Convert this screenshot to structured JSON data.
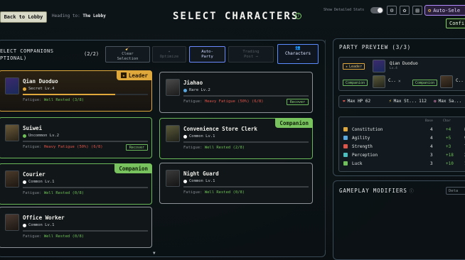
{
  "header": {
    "back_label": "Back to Lobby",
    "heading_prefix": "Heading to:",
    "heading_dest": "The Lobby",
    "title": "SELECT CHARACTERS",
    "help_glyph": "?",
    "show_stats_label": "Show Detailed Stats",
    "auto_select_label": "Auto-Sele",
    "confirm_label": "Confi",
    "icons": [
      "settings-icon",
      "gear-icon",
      "bookmark-icon"
    ]
  },
  "companions": {
    "heading_line1": "ELECT COMPANIONS",
    "heading_line2": "PTIONAL)",
    "count": "(2/2)",
    "buttons": {
      "clear_line1": "Clear",
      "clear_line2": "Selection",
      "optimize": "Optimize",
      "auto_line1": "Auto-",
      "auto_line2": "Party",
      "trading_line1": "Trading",
      "trading_line2": "Post →",
      "characters_line1": "Characters",
      "characters_line2": "→"
    },
    "cards": [
      {
        "name": "Qian Duoduo",
        "rank": "Secret Lv.4",
        "fatigue_label": "Fatigue:",
        "fatigue": "Well Rested (3/8)",
        "tag": "Leader",
        "rank_color": "#e0a83a",
        "fatigue_ok": true,
        "bar": 0.8
      },
      {
        "name": "Jiahao",
        "rank": "Rare Lv.2",
        "fatigue_label": "Fatigue:",
        "fatigue": "Heavy Fatigue (50%) (6/8)",
        "recover": "Recover",
        "rank_color": "#5aa8e0",
        "fatigue_ok": false,
        "bar": 0.0
      },
      {
        "name": "Suiwei",
        "rank": "Uncommon Lv.2",
        "fatigue_label": "Fatigue:",
        "fatigue": "Heavy Fatigue (50%) (6/8)",
        "recover": "Recover",
        "rank_color": "#6fc058",
        "fatigue_ok": false,
        "bar": 0.0
      },
      {
        "name": "Convenience Store Clerk",
        "rank": "Common Lv.1",
        "fatigue_label": "Fatigue:",
        "fatigue": "Well Rested (2/8)",
        "tag": "Companion",
        "rank_color": "#ffffff",
        "fatigue_ok": true,
        "bar": 0.0
      },
      {
        "name": "Courier",
        "rank": "Common Lv.1",
        "fatigue_label": "Fatigue:",
        "fatigue": "Well Rested (0/8)",
        "tag": "Companion",
        "rank_color": "#ffffff",
        "fatigue_ok": true,
        "bar": 0.0
      },
      {
        "name": "Night Guard",
        "rank": "Common Lv.1",
        "fatigue_label": "Fatigue:",
        "fatigue": "Well Rested (0/8)",
        "rank_color": "#ffffff",
        "fatigue_ok": true,
        "bar": 0.0
      },
      {
        "name": "Office Worker",
        "rank": "Common Lv.1",
        "fatigue_label": "Fatigue:",
        "fatigue": "Well Rested (0/8)",
        "rank_color": "#ffffff",
        "fatigue_ok": true,
        "bar": 0.0
      }
    ]
  },
  "party": {
    "title": "PARTY PREVIEW (3/3)",
    "leader_tag": "Leader",
    "leader_name": "Qian Duoduo",
    "leader_sub": "Lv.4",
    "companion_tag": "Companion",
    "comp1_name": "C..",
    "comp2_name": "C..",
    "stats": {
      "hp": "Max HP 62",
      "stamina_label": "Max St...",
      "stamina": "112",
      "sanity": "Max Sa..."
    },
    "table_headers": {
      "base": "Base",
      "char": "Char"
    },
    "attributes": [
      {
        "name": "Constitution",
        "base": "4",
        "bonus": "+4",
        "total": "8",
        "color": "#e0a83a"
      },
      {
        "name": "Agility",
        "base": "4",
        "bonus": "+5",
        "total": "9",
        "color": "#5aa8e0"
      },
      {
        "name": "Strength",
        "base": "4",
        "bonus": "+3",
        "total": "7",
        "color": "#e0554a"
      },
      {
        "name": "Perception",
        "base": "3",
        "bonus": "+18",
        "total": "21",
        "color": "#4ac0c0"
      },
      {
        "name": "Luck",
        "base": "3",
        "bonus": "+10",
        "total": "13",
        "color": "#6fc058"
      }
    ]
  },
  "modifiers": {
    "title": "GAMEPLAY MODIFIERS",
    "button": "Deta"
  }
}
